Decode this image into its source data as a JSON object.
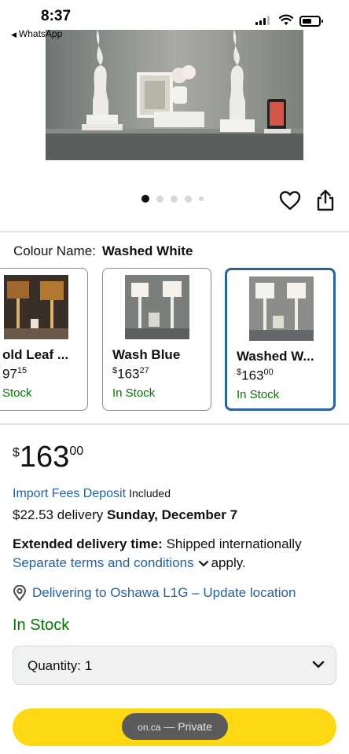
{
  "status_bar": {
    "time": "8:37",
    "back_app": "WhatsApp",
    "icons": [
      "cellular-signal-icon",
      "wifi-icon",
      "battery-icon"
    ]
  },
  "gallery": {
    "image_count": 5,
    "active_index": 0,
    "actions": [
      "heart-icon",
      "share-icon"
    ]
  },
  "colour": {
    "label": "Colour Name:",
    "value": "Washed White",
    "options": [
      {
        "name": "old Leaf ...",
        "price_whole": "97",
        "price_frac": "15",
        "stock": "Stock"
      },
      {
        "name": "Wash Blue",
        "price_symbol": "$",
        "price_whole": "163",
        "price_frac": "27",
        "stock": "In Stock"
      },
      {
        "name": "Washed W...",
        "price_symbol": "$",
        "price_whole": "163",
        "price_frac": "00",
        "stock": "In Stock"
      }
    ]
  },
  "price": {
    "symbol": "$",
    "whole": "163",
    "fraction": "00"
  },
  "import": {
    "link": "Import Fees Deposit",
    "status": "Included"
  },
  "delivery": {
    "text": "$22.53 delivery",
    "date": "Sunday, December 7"
  },
  "extended": {
    "label": "Extended delivery time:",
    "text": "Shipped internationally",
    "terms_link": "Separate terms and conditions",
    "terms_suffix": "apply."
  },
  "location": {
    "text": "Delivering to Oshawa L1G – Update location"
  },
  "availability": "In Stock",
  "quantity": {
    "label": "Quantity: 1"
  },
  "browser": {
    "domain": "on.ca",
    "mode": "— Private"
  },
  "colors": {
    "link": "#2162a1",
    "in_stock": "#007600",
    "selected_border": "#2b6597",
    "cta": "#ffd814"
  }
}
